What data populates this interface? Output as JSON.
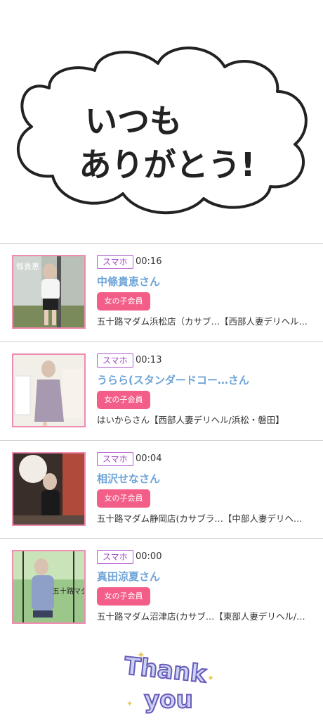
{
  "banner": {
    "line1": "いつも",
    "line2": "ありがとう!"
  },
  "entries": [
    {
      "badge": "スマホ",
      "time": "00:16",
      "name": "中條貴恵さん",
      "member_label": "女の子会員",
      "shop": "五十路マダム浜松店（カサブ…【西部人妻デリヘル…",
      "thumb_caption": "條貴恵"
    },
    {
      "badge": "スマホ",
      "time": "00:13",
      "name": "うらら(スタンダードコー…さん",
      "member_label": "女の子会員",
      "shop": "はいからさん【西部人妻デリヘル/浜松・磐田】",
      "thumb_caption": ""
    },
    {
      "badge": "スマホ",
      "time": "00:04",
      "name": "相沢せなさん",
      "member_label": "女の子会員",
      "shop": "五十路マダム静岡店(カサブラ…【中部人妻デリヘ…",
      "thumb_caption": ""
    },
    {
      "badge": "スマホ",
      "time": "00:00",
      "name": "真田涼夏さん",
      "member_label": "女の子会員",
      "shop": "五十路マダム沼津店(カサブ…【東部人妻デリヘル/…",
      "thumb_caption": "五十路マダム"
    }
  ],
  "thank_you": {
    "line1": "Thank",
    "line2": "you"
  }
}
